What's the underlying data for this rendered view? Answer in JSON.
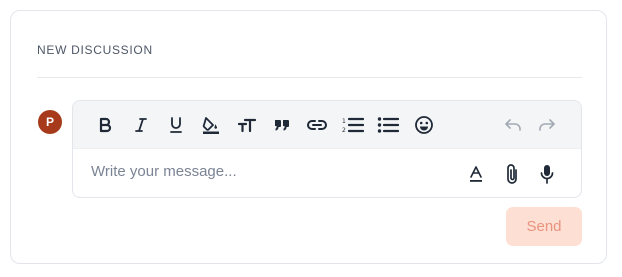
{
  "section": {
    "title": "NEW DISCUSSION"
  },
  "user": {
    "avatar_initial": "P",
    "avatar_color": "#a63a1b"
  },
  "editor": {
    "placeholder": "Write your message...",
    "value": "",
    "toolbar": [
      {
        "name": "bold",
        "icon": "bold-icon"
      },
      {
        "name": "italic",
        "icon": "italic-icon"
      },
      {
        "name": "underline",
        "icon": "underline-icon"
      },
      {
        "name": "highlight",
        "icon": "paint-bucket-icon"
      },
      {
        "name": "text-size",
        "icon": "text-size-icon"
      },
      {
        "name": "quote",
        "icon": "quote-icon"
      },
      {
        "name": "link",
        "icon": "link-icon"
      },
      {
        "name": "ordered-list",
        "icon": "ordered-list-icon"
      },
      {
        "name": "bullet-list",
        "icon": "bullet-list-icon"
      },
      {
        "name": "emoji",
        "icon": "emoji-icon"
      },
      {
        "name": "undo",
        "icon": "undo-icon"
      },
      {
        "name": "redo",
        "icon": "redo-icon"
      }
    ],
    "input_actions": [
      {
        "name": "text-format",
        "icon": "text-format-icon"
      },
      {
        "name": "attach",
        "icon": "paperclip-icon"
      },
      {
        "name": "voice",
        "icon": "microphone-icon"
      }
    ]
  },
  "actions": {
    "send_label": "Send",
    "send_enabled": false,
    "send_bg": "#fde0d3",
    "send_color": "#e9927e"
  }
}
